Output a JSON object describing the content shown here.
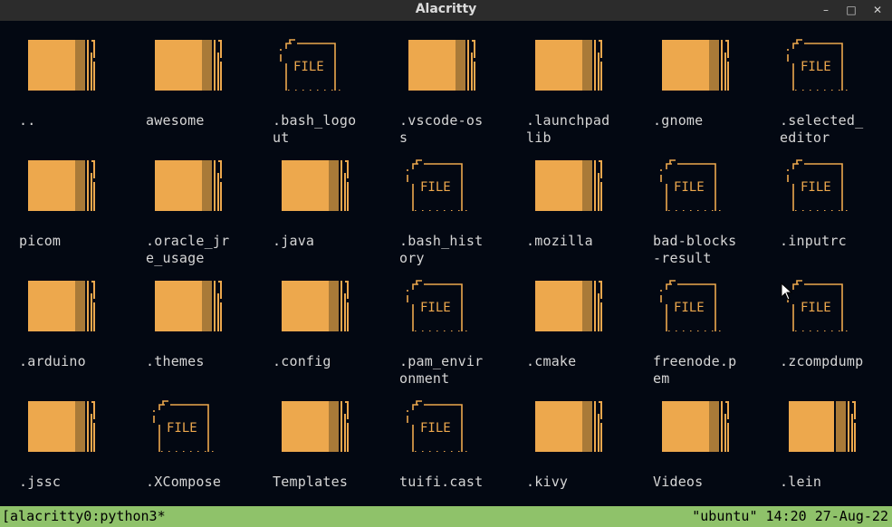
{
  "window": {
    "title": "Alacritty",
    "controls": {
      "minimize": "–",
      "maximize": "□",
      "close": "✕"
    }
  },
  "files": [
    {
      "name": "..",
      "type": "folder",
      "label_lines": [
        ".."
      ]
    },
    {
      "name": "awesome",
      "type": "folder",
      "label_lines": [
        "awesome"
      ]
    },
    {
      "name": ".bash_logout",
      "type": "file",
      "label_lines": [
        ".bash_logo",
        "ut"
      ]
    },
    {
      "name": ".vscode-oss",
      "type": "folder",
      "label_lines": [
        ".vscode-os",
        "s"
      ]
    },
    {
      "name": ".launchpadlib",
      "type": "folder",
      "label_lines": [
        ".launchpad",
        "lib"
      ]
    },
    {
      "name": ".gnome",
      "type": "folder",
      "label_lines": [
        ".gnome"
      ]
    },
    {
      "name": ".selected_editor",
      "type": "file",
      "label_lines": [
        ".selected_",
        "editor"
      ]
    },
    {
      "name": "picom",
      "type": "folder",
      "label_lines": [
        "picom"
      ]
    },
    {
      "name": ".oracle_jre_usage",
      "type": "folder",
      "label_lines": [
        ".oracle_jr",
        "e_usage"
      ]
    },
    {
      "name": ".java",
      "type": "folder",
      "label_lines": [
        ".java"
      ]
    },
    {
      "name": ".bash_history",
      "type": "file",
      "label_lines": [
        ".bash_hist",
        "ory"
      ]
    },
    {
      "name": ".mozilla",
      "type": "folder",
      "label_lines": [
        ".mozilla"
      ]
    },
    {
      "name": "bad-blocks-result",
      "type": "file",
      "label_lines": [
        "bad-blocks",
        "-result"
      ]
    },
    {
      "name": ".inputrc",
      "type": "file",
      "label_lines": [
        ".inputrc"
      ]
    },
    {
      "name": ".arduino",
      "type": "folder",
      "label_lines": [
        ".arduino"
      ]
    },
    {
      "name": ".themes",
      "type": "folder",
      "label_lines": [
        ".themes"
      ]
    },
    {
      "name": ".config",
      "type": "folder",
      "label_lines": [
        ".config"
      ]
    },
    {
      "name": ".pam_environment",
      "type": "file",
      "label_lines": [
        ".pam_envir",
        "onment"
      ]
    },
    {
      "name": ".cmake",
      "type": "folder",
      "label_lines": [
        ".cmake"
      ]
    },
    {
      "name": "freenode.pem",
      "type": "file",
      "label_lines": [
        "freenode.p",
        "em"
      ]
    },
    {
      "name": ".zcompdump",
      "type": "file",
      "label_lines": [
        ".zcompdump"
      ]
    },
    {
      "name": ".jssc",
      "type": "folder",
      "label_lines": [
        ".jssc"
      ]
    },
    {
      "name": ".XCompose",
      "type": "file",
      "label_lines": [
        ".XCompose"
      ]
    },
    {
      "name": "Templates",
      "type": "folder",
      "label_lines": [
        "Templates"
      ]
    },
    {
      "name": "tuifi.cast",
      "type": "file",
      "label_lines": [
        "tuifi.cast"
      ]
    },
    {
      "name": ".kivy",
      "type": "folder",
      "label_lines": [
        ".kivy"
      ]
    },
    {
      "name": "Videos",
      "type": "folder",
      "label_lines": [
        "Videos"
      ]
    },
    {
      "name": ".lein",
      "type": "folder",
      "label_lines": [
        ".lein"
      ]
    }
  ],
  "file_icon_text": "FILE",
  "colors": {
    "background": "#030812",
    "folder_front": "#eda84d",
    "folder_back": "#a97a38",
    "folder_lines": "#eda84d",
    "file_icon": "#eda84d",
    "label": "#d6d6d6",
    "statusbar": "#8fc26a"
  },
  "statusbar": {
    "left": "[alacritty0:python3*",
    "right": "\"ubuntu\" 14:20 27-Aug-22"
  }
}
